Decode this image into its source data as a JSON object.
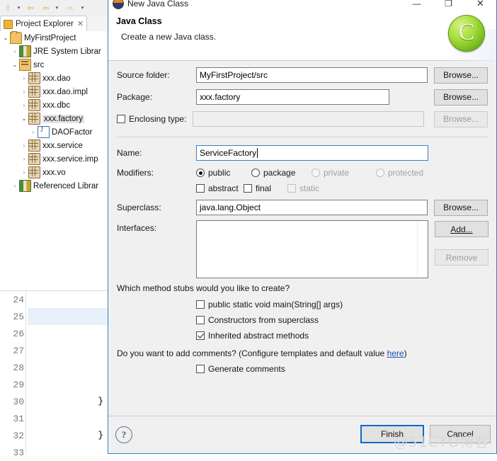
{
  "ide": {
    "toolbar": {
      "buttons": [
        {
          "name": "up-arrow-icon",
          "glyph": "⇧"
        },
        {
          "name": "back-arrow-icon",
          "glyph": "⇦"
        },
        {
          "name": "back-arrow-2-icon",
          "glyph": "⇦"
        },
        {
          "name": "forward-arrow-icon",
          "glyph": "⇨"
        }
      ],
      "caret": "▾"
    },
    "explorer_tab": {
      "label": "Project Explorer",
      "close_glyph": "✕",
      "icon": "project-explorer-icon"
    },
    "tree": [
      {
        "label": "MyFirstProject",
        "indent": 0,
        "twisty": "open",
        "icon": "project-icon",
        "selected": false
      },
      {
        "label": "JRE System Librar",
        "indent": 1,
        "twisty": "closed",
        "icon": "library-icon",
        "selected": false
      },
      {
        "label": "src",
        "indent": 1,
        "twisty": "open",
        "icon": "source-folder-icon",
        "selected": false
      },
      {
        "label": "xxx.dao",
        "indent": 2,
        "twisty": "closed",
        "icon": "package-icon",
        "selected": false
      },
      {
        "label": "xxx.dao.impl",
        "indent": 2,
        "twisty": "closed",
        "icon": "package-icon",
        "selected": false
      },
      {
        "label": "xxx.dbc",
        "indent": 2,
        "twisty": "closed",
        "icon": "package-icon",
        "selected": false
      },
      {
        "label": "xxx.factory",
        "indent": 2,
        "twisty": "open",
        "icon": "package-icon",
        "selected": true
      },
      {
        "label": "DAOFactor",
        "indent": 3,
        "twisty": "closed",
        "icon": "java-file-icon",
        "selected": false
      },
      {
        "label": "xxx.service",
        "indent": 2,
        "twisty": "closed",
        "icon": "package-icon",
        "selected": false
      },
      {
        "label": "xxx.service.imp",
        "indent": 2,
        "twisty": "closed",
        "icon": "package-icon",
        "selected": false
      },
      {
        "label": "xxx.vo",
        "indent": 2,
        "twisty": "closed",
        "icon": "package-icon",
        "selected": false
      },
      {
        "label": "Referenced Librar",
        "indent": 1,
        "twisty": "closed",
        "icon": "library-icon",
        "selected": false
      }
    ],
    "editor_lines": [
      {
        "number": "24",
        "code": "",
        "highlight": false
      },
      {
        "number": "25",
        "code": "",
        "highlight": true
      },
      {
        "number": "26",
        "code": "",
        "highlight": false
      },
      {
        "number": "27",
        "code": "",
        "highlight": false
      },
      {
        "number": "28",
        "code": "",
        "highlight": false
      },
      {
        "number": "29",
        "code": "",
        "highlight": false
      },
      {
        "number": "30",
        "code": "}",
        "highlight": false
      },
      {
        "number": "31",
        "code": "",
        "highlight": false
      },
      {
        "number": "32",
        "code": "}",
        "highlight": false
      },
      {
        "number": "33",
        "code": "",
        "highlight": false
      }
    ]
  },
  "dialog": {
    "window_title": "New Java Class",
    "window_buttons": {
      "minimize": "—",
      "maximize": "❐",
      "close": "✕"
    },
    "banner": {
      "title": "Java Class",
      "subtitle": "Create a new Java class.",
      "logo_letter": "C"
    },
    "fields": {
      "source_folder": {
        "label": "Source folder:",
        "value": "MyFirstProject/src",
        "button": "Browse..."
      },
      "package": {
        "label": "Package:",
        "value": "xxx.factory",
        "button": "Browse..."
      },
      "enclosing_type": {
        "label": "Enclosing type:",
        "value": "",
        "button": "Browse...",
        "checked": false,
        "disabled": true
      },
      "name": {
        "label": "Name:",
        "value": "ServiceFactory"
      },
      "superclass": {
        "label": "Superclass:",
        "value": "java.lang.Object",
        "button": "Browse..."
      },
      "interfaces": {
        "label": "Interfaces:",
        "add_button": "Add...",
        "remove_button": "Remove",
        "items": []
      }
    },
    "modifiers": {
      "label": "Modifiers:",
      "radios": [
        {
          "label": "public",
          "checked": true,
          "disabled": false
        },
        {
          "label": "package",
          "checked": false,
          "disabled": false
        },
        {
          "label": "private",
          "checked": false,
          "disabled": true
        },
        {
          "label": "protected",
          "checked": false,
          "disabled": true
        }
      ],
      "checks": [
        {
          "label": "abstract",
          "checked": false,
          "disabled": false
        },
        {
          "label": "final",
          "checked": false,
          "disabled": false
        },
        {
          "label": "static",
          "checked": false,
          "disabled": true
        }
      ]
    },
    "stubs": {
      "question": "Which method stubs would you like to create?",
      "options": [
        {
          "label": "public static void main(String[] args)",
          "checked": false
        },
        {
          "label": "Constructors from superclass",
          "checked": false
        },
        {
          "label": "Inherited abstract methods",
          "checked": true
        }
      ]
    },
    "comments": {
      "question_prefix": "Do you want to add comments? (Configure templates and default value ",
      "link": "here",
      "question_suffix": ")",
      "option": {
        "label": "Generate comments",
        "checked": false
      }
    },
    "footer": {
      "help": "?",
      "finish": "Finish",
      "cancel": "Cancel"
    }
  },
  "watermark": "@51CTO博客"
}
